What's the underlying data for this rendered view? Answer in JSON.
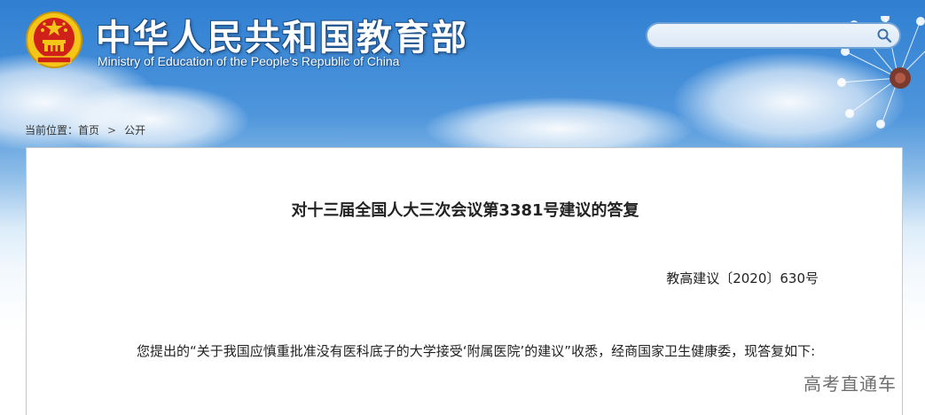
{
  "header": {
    "site_title": "中华人民共和国教育部",
    "site_subtitle": "Ministry of Education of the People's Republic of China"
  },
  "search": {
    "placeholder": "",
    "value": "",
    "icon": "search-icon"
  },
  "breadcrumb": {
    "prefix": "当前位置：",
    "home": "首页",
    "separator": ">",
    "current": "公开"
  },
  "document": {
    "title": "对十三届全国人大三次会议第3381号建议的答复",
    "number": "教高建议〔2020〕630号",
    "paragraph": "您提出的“关于我国应慎重批准没有医科底子的大学接受‘附属医院’的建议”收悉，经商国家卫生健康委，现答复如下:"
  },
  "watermark": "高考直通车",
  "colors": {
    "header_blue": "#2f7fd2",
    "emblem_red": "#d0201a",
    "emblem_gold": "#f5c518",
    "text": "#222222"
  }
}
